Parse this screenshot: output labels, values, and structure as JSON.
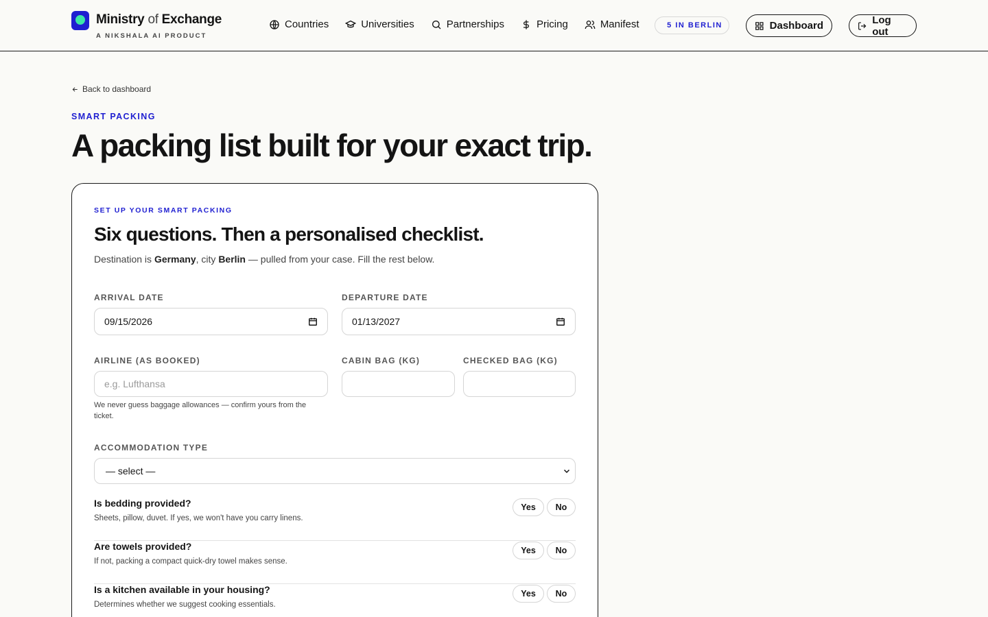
{
  "header": {
    "brand_main": "Ministry",
    "brand_of": "of",
    "brand_tail": "Exchange",
    "brand_sub": "A NIKSHALA AI PRODUCT",
    "nav": [
      {
        "label": "Countries",
        "icon": "globe-icon"
      },
      {
        "label": "Universities",
        "icon": "graduation-cap-icon"
      },
      {
        "label": "Partnerships",
        "icon": "search-icon"
      },
      {
        "label": "Pricing",
        "icon": "dollar-icon"
      },
      {
        "label": "Manifest",
        "icon": "users-icon"
      }
    ],
    "badge": "5 IN BERLIN",
    "dashboard_label": "Dashboard",
    "logout_label": "Log out"
  },
  "page": {
    "back_label": "Back to dashboard",
    "eyebrow": "SMART PACKING",
    "headline": "A packing list built for your exact trip."
  },
  "card": {
    "eyebrow": "SET UP YOUR SMART PACKING",
    "title": "Six questions. Then a personalised checklist.",
    "desc_prefix": "Destination is ",
    "country": "Germany",
    "desc_mid": ", city ",
    "city": "Berlin",
    "desc_suffix": " — pulled from your case. Fill the rest below.",
    "arrival_label": "ARRIVAL DATE",
    "arrival_value": "09/15/2026",
    "departure_label": "DEPARTURE DATE",
    "departure_value": "01/13/2027",
    "airline_label": "AIRLINE (AS BOOKED)",
    "airline_placeholder": "e.g. Lufthansa",
    "cabin_label": "CABIN BAG (KG)",
    "checked_label": "CHECKED BAG (KG)",
    "hint": "We never guess baggage allowances — confirm yours from the ticket.",
    "accommodation_label": "ACCOMMODATION TYPE",
    "accommodation_value": "— select —",
    "questions": [
      {
        "title": "Is bedding provided?",
        "sub": "Sheets, pillow, duvet. If yes, we won't have you carry linens."
      },
      {
        "title": "Are towels provided?",
        "sub": "If not, packing a compact quick-dry towel makes sense."
      },
      {
        "title": "Is a kitchen available in your housing?",
        "sub": "Determines whether we suggest cooking essentials."
      }
    ],
    "yes_label": "Yes",
    "no_label": "No"
  },
  "colors": {
    "accent": "#1f1fd1",
    "logo_dot": "#3ee6a8",
    "background": "#fafaf7"
  }
}
